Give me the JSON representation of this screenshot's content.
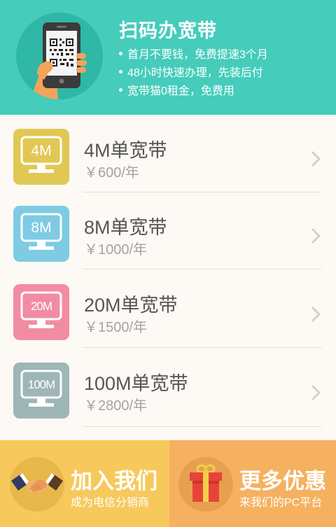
{
  "banner": {
    "title": "扫码办宽带",
    "bullets": [
      "首月不要钱，免费提速3个月",
      "48小时快速办理，先装后付",
      "宽带猫0租金，免费用"
    ],
    "colors": {
      "background": "#45ccbb",
      "circle": "#2fb8a6"
    }
  },
  "plans": [
    {
      "speed": "4M",
      "name": "4M单宽带",
      "price": "￥600/年",
      "color": "#e1c854"
    },
    {
      "speed": "8M",
      "name": "8M单宽带",
      "price": "￥1000/年",
      "color": "#7ecbe3"
    },
    {
      "speed": "20M",
      "name": "20M单宽带",
      "price": "￥1500/年",
      "color": "#f28ca3"
    },
    {
      "speed": "100M",
      "name": "100M单宽带",
      "price": "￥2800/年",
      "color": "#9fb6b7"
    }
  ],
  "panels": {
    "join": {
      "title": "加入我们",
      "subtitle": "成为电信分销商",
      "icon": "handshake-icon",
      "color": "#f7c95c"
    },
    "more": {
      "title": "更多优惠",
      "subtitle": "来我们的PC平台",
      "icon": "gift-box-icon",
      "color": "#f5b160"
    }
  }
}
